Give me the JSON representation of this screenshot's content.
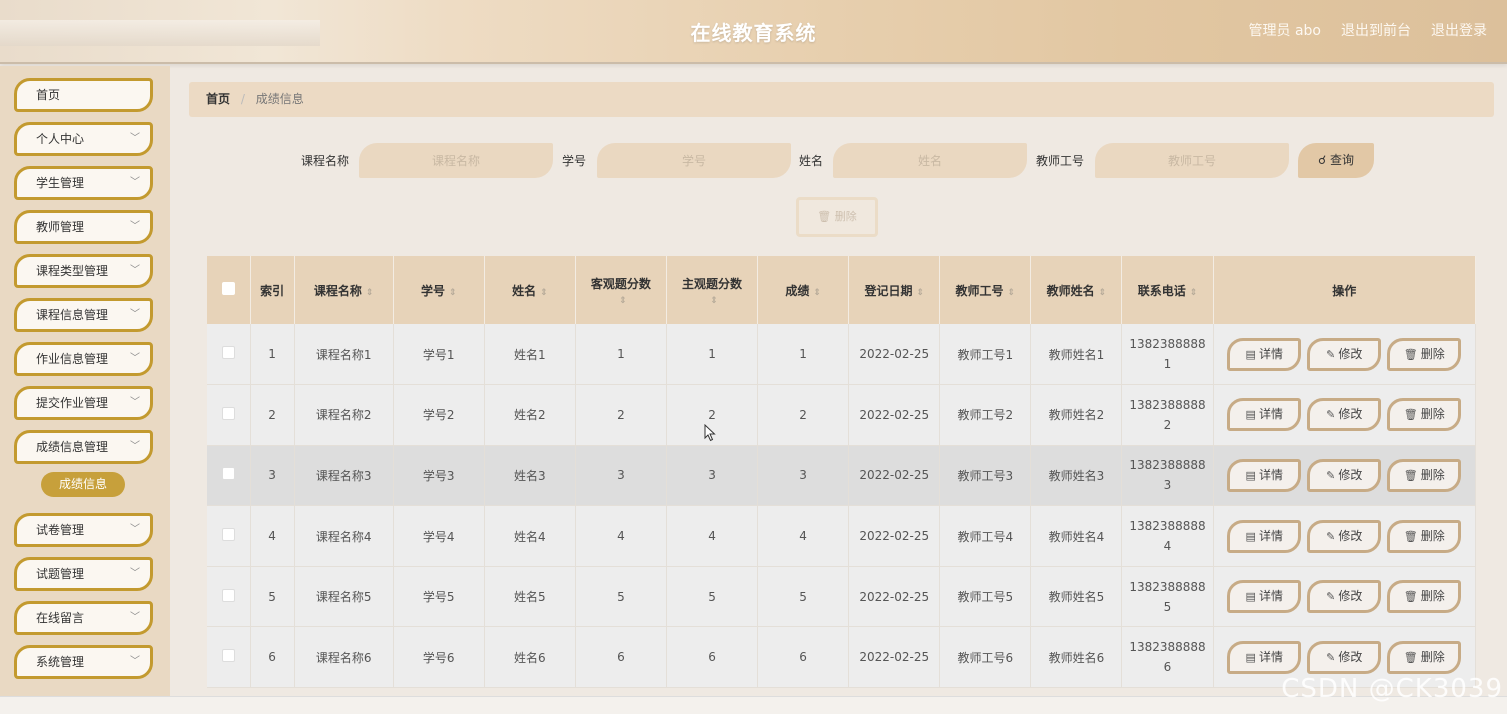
{
  "header": {
    "title": "在线教育系统",
    "user_label": "管理员 abo",
    "to_front": "退出到前台",
    "logout": "退出登录"
  },
  "sidebar": {
    "items": [
      {
        "label": "首页",
        "has_chevron": false
      },
      {
        "label": "个人中心",
        "has_chevron": true
      },
      {
        "label": "学生管理",
        "has_chevron": true
      },
      {
        "label": "教师管理",
        "has_chevron": true
      },
      {
        "label": "课程类型管理",
        "has_chevron": true
      },
      {
        "label": "课程信息管理",
        "has_chevron": true
      },
      {
        "label": "作业信息管理",
        "has_chevron": true
      },
      {
        "label": "提交作业管理",
        "has_chevron": true
      },
      {
        "label": "成绩信息管理",
        "has_chevron": true
      },
      {
        "label": "试卷管理",
        "has_chevron": true
      },
      {
        "label": "试题管理",
        "has_chevron": true
      },
      {
        "label": "在线留言",
        "has_chevron": true
      },
      {
        "label": "系统管理",
        "has_chevron": true
      }
    ],
    "active_sub": "成绩信息"
  },
  "breadcrumb": {
    "home": "首页",
    "separator": "/",
    "current": "成绩信息"
  },
  "search": {
    "course_label": "课程名称",
    "course_placeholder": "课程名称",
    "student_no_label": "学号",
    "student_no_placeholder": "学号",
    "name_label": "姓名",
    "name_placeholder": "姓名",
    "teacher_no_label": "教师工号",
    "teacher_no_placeholder": "教师工号",
    "query_button": "查询"
  },
  "bulk_delete_label": "删除",
  "table": {
    "headers": {
      "index": "索引",
      "course": "课程名称",
      "student_no": "学号",
      "name": "姓名",
      "objective": "客观题分数",
      "subjective": "主观题分数",
      "score": "成绩",
      "date": "登记日期",
      "teacher_no": "教师工号",
      "teacher_name": "教师姓名",
      "phone": "联系电话",
      "actions": "操作"
    },
    "actions": {
      "detail": "详情",
      "edit": "修改",
      "delete": "删除"
    },
    "rows": [
      {
        "index": "1",
        "course": "课程名称1",
        "student_no": "学号1",
        "name": "姓名1",
        "objective": "1",
        "subjective": "1",
        "score": "1",
        "date": "2022-02-25",
        "teacher_no": "教师工号1",
        "teacher_name": "教师姓名1",
        "phone_a": "1382388888",
        "phone_b": "1"
      },
      {
        "index": "2",
        "course": "课程名称2",
        "student_no": "学号2",
        "name": "姓名2",
        "objective": "2",
        "subjective": "2",
        "score": "2",
        "date": "2022-02-25",
        "teacher_no": "教师工号2",
        "teacher_name": "教师姓名2",
        "phone_a": "1382388888",
        "phone_b": "2"
      },
      {
        "index": "3",
        "course": "课程名称3",
        "student_no": "学号3",
        "name": "姓名3",
        "objective": "3",
        "subjective": "3",
        "score": "3",
        "date": "2022-02-25",
        "teacher_no": "教师工号3",
        "teacher_name": "教师姓名3",
        "phone_a": "1382388888",
        "phone_b": "3"
      },
      {
        "index": "4",
        "course": "课程名称4",
        "student_no": "学号4",
        "name": "姓名4",
        "objective": "4",
        "subjective": "4",
        "score": "4",
        "date": "2022-02-25",
        "teacher_no": "教师工号4",
        "teacher_name": "教师姓名4",
        "phone_a": "1382388888",
        "phone_b": "4"
      },
      {
        "index": "5",
        "course": "课程名称5",
        "student_no": "学号5",
        "name": "姓名5",
        "objective": "5",
        "subjective": "5",
        "score": "5",
        "date": "2022-02-25",
        "teacher_no": "教师工号5",
        "teacher_name": "教师姓名5",
        "phone_a": "1382388888",
        "phone_b": "5"
      },
      {
        "index": "6",
        "course": "课程名称6",
        "student_no": "学号6",
        "name": "姓名6",
        "objective": "6",
        "subjective": "6",
        "score": "6",
        "date": "2022-02-25",
        "teacher_no": "教师工号6",
        "teacher_name": "教师姓名6",
        "phone_a": "1382388888",
        "phone_b": "6"
      }
    ]
  },
  "watermark": "CSDN @CK3039"
}
